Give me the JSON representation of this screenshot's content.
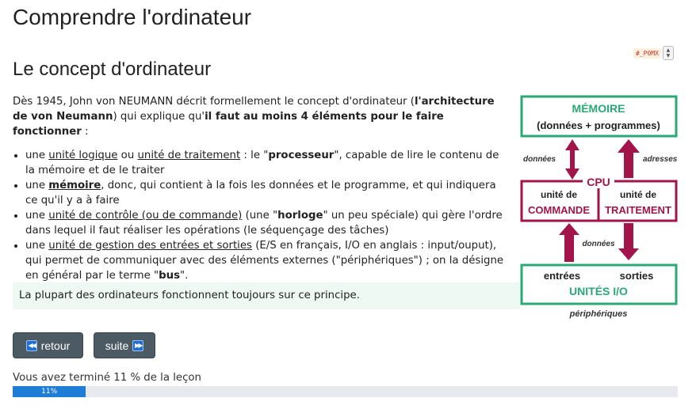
{
  "header": {
    "title": "Comprendre l'ordinateur"
  },
  "widget": {
    "tag": "#_P0MX"
  },
  "section": {
    "title": "Le concept d'ordinateur"
  },
  "intro": {
    "text1": "Dès 1945, John von NEUMANN décrit formellement le concept d'ordinateur (",
    "bold1": "l'architecture de von Neumann",
    "text2": ") qui explique qu'",
    "bold2": "il faut au moins 4 éléments pour le faire fonctionner",
    "text3": " :"
  },
  "items": [
    {
      "a": "une ",
      "u1": "unité logique",
      "b": " ou ",
      "u2": "unité de traitement",
      "c": " : le \"",
      "bold": "processeur",
      "d": "\", capable de lire le contenu de la mémoire et de le traiter"
    },
    {
      "a": "une ",
      "ub": "mémoire",
      "b": ", donc, qui contient à la fois les données et le programme, et qui indiquera ce qu'il y a à faire"
    },
    {
      "a": "une ",
      "u1": "unité de contrôle (ou de commande)",
      "b": " (une \"",
      "bold": "horloge",
      "c": "\" un peu spéciale) qui gère l'ordre dans lequel il faut réaliser les opérations (le séquençage des tâches)"
    },
    {
      "a": "une ",
      "u1": "unité de gestion des entrées et sorties",
      "b": " (E/S en français, I/O en anglais : input/ouput), qui permet de communiquer avec des éléments externes (\"périphériques\") ; on la désigne en général par le terme \"",
      "bold": "bus",
      "c": "\"."
    }
  ],
  "note": {
    "text": "La plupart des ordinateurs fonctionnent toujours sur ce principe."
  },
  "diagram": {
    "memoire_title": "MÉMOIRE",
    "memoire_sub": "(données + programmes)",
    "donnees_top": "données",
    "adresses": "adresses",
    "cpu": "CPU",
    "commande_line1": "unité de",
    "commande_line2": "COMMANDE",
    "traitement_line1": "unité de",
    "traitement_line2": "TRAITEMENT",
    "donnees_bottom": "données",
    "entrees": "entrées",
    "sorties": "sorties",
    "io_title": "UNITÉS I/O",
    "peripheriques": "périphériques",
    "colors": {
      "green": "#2aa876",
      "red": "#a3154a"
    }
  },
  "nav": {
    "retour": "retour",
    "suite": "suite"
  },
  "progress": {
    "label": "Vous avez terminé 11 % de la leçon",
    "value": 11,
    "display": "11%"
  }
}
